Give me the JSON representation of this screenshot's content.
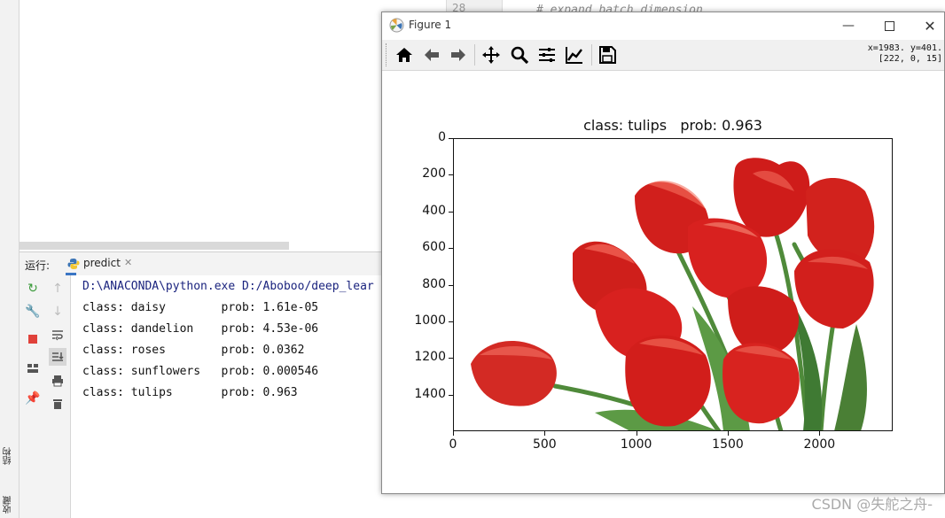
{
  "ide": {
    "stripe_tabs": [
      "结构",
      "收藏"
    ],
    "gutter_line": "28",
    "code_peek": "# expand batch dimension",
    "run_panel": {
      "label": "运行:",
      "tab_label": "predict",
      "console_lines": [
        "D:\\ANACONDA\\python.exe D:/Aboboo/deep_lear",
        "class: daisy        prob: 1.61e-05",
        "class: dandelion    prob: 4.53e-06",
        "class: roses        prob: 0.0362",
        "class: sunflowers   prob: 0.000546",
        "class: tulips       prob: 0.963"
      ]
    }
  },
  "figure": {
    "window_title": "Figure 1",
    "coords_readout": "x=1983. y=401.\n[222, 0, 15]",
    "toolbar_icons": [
      "home-icon",
      "back-arrow-icon",
      "forward-arrow-icon",
      "pan-icon",
      "zoom-icon",
      "configure-subplots-icon",
      "edit-axis-icon",
      "save-icon"
    ],
    "plot": {
      "title": "class: tulips   prob: 0.963",
      "x_ticks": [
        "0",
        "500",
        "1000",
        "1500",
        "2000"
      ],
      "y_ticks": [
        "0",
        "200",
        "400",
        "600",
        "800",
        "1000",
        "1200",
        "1400"
      ],
      "xlim": [
        0,
        2400
      ],
      "ylim": [
        1600,
        0
      ]
    }
  },
  "watermark": "CSDN @失舵之舟-",
  "colors": {
    "petal_red": "#d8211f",
    "stem_green": "#4f8a3a",
    "run_tab_accent": "#3a75c4",
    "console_cmd": "#1a237e"
  }
}
